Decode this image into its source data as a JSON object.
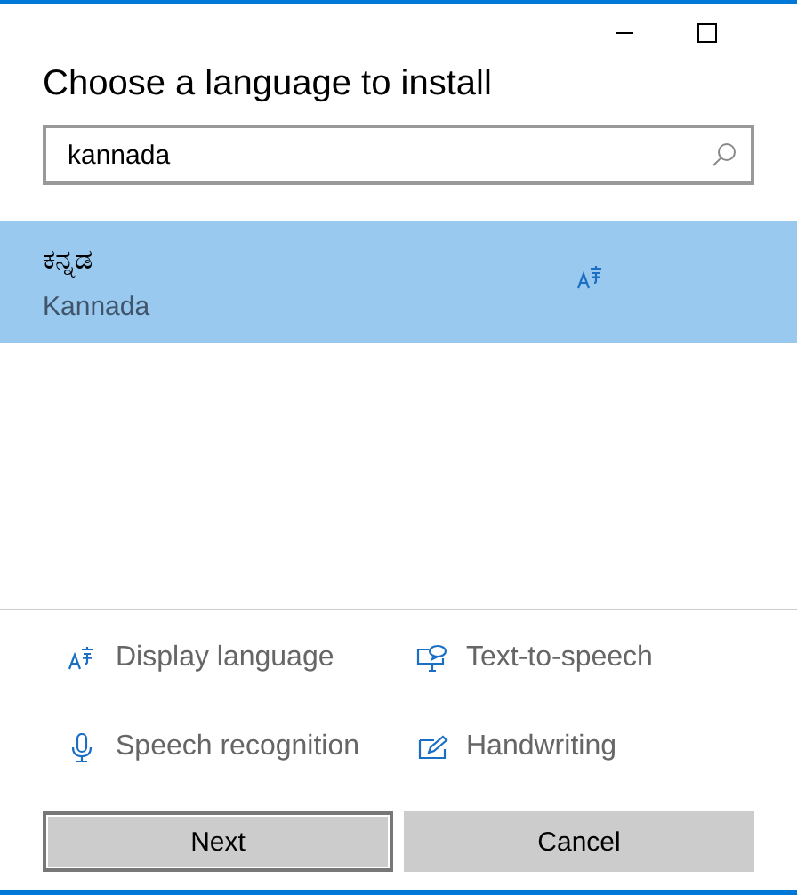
{
  "window": {
    "title": "Choose a language to install"
  },
  "search": {
    "value": "kannada"
  },
  "languages": [
    {
      "native_name": "ಕನ್ನಡ",
      "name": "Kannada",
      "selected": true
    }
  ],
  "features": [
    {
      "kind": "display",
      "label": "Display language"
    },
    {
      "kind": "tts",
      "label": "Text-to-speech"
    },
    {
      "kind": "speech",
      "label": "Speech recognition"
    },
    {
      "kind": "handwriting",
      "label": "Handwriting"
    }
  ],
  "buttons": [
    {
      "label": "Next",
      "focused": true
    },
    {
      "label": "Cancel",
      "focused": false
    }
  ]
}
